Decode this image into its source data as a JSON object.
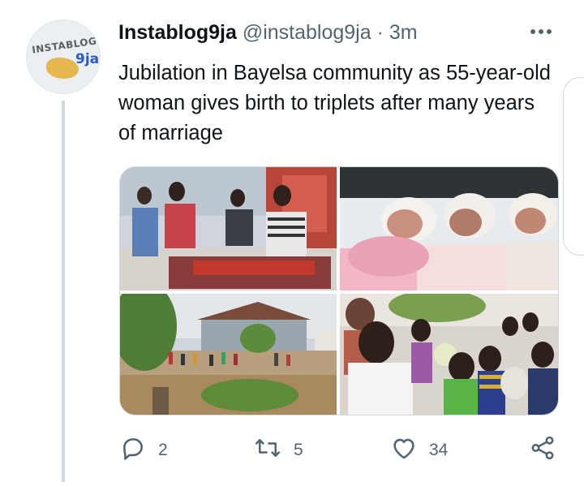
{
  "tweet": {
    "display_name": "Instablog9ja",
    "handle": "@instablog9ja",
    "separator": "·",
    "time": "3m",
    "text": "Jubilation in Bayelsa community as 55-year-old woman gives birth to triplets after many years of marriage"
  },
  "avatar": {
    "icon": "instablog9ja-logo",
    "logo_text": "INSTABLOG",
    "logo_suffix": "9ja"
  },
  "media": [
    {
      "name": "photo-hospital-room"
    },
    {
      "name": "photo-newborn-triplets"
    },
    {
      "name": "photo-community-street"
    },
    {
      "name": "photo-celebrating-crowd"
    }
  ],
  "actions": {
    "reply_count": "2",
    "retweet_count": "5",
    "like_count": "34",
    "share_label": ""
  },
  "colors": {
    "text": "#0f1419",
    "secondary": "#536471",
    "border": "#cfd9de"
  }
}
